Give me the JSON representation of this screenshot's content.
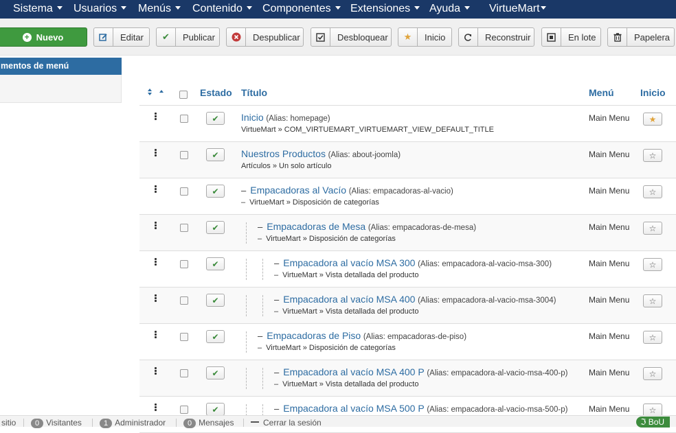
{
  "nav": {
    "items": [
      "Sistema",
      "Usuarios",
      "Menús",
      "Contenido",
      "Componentes",
      "Extensiones",
      "Ayuda",
      "VirtueMart"
    ]
  },
  "toolbar": {
    "new_label": "Nuevo",
    "edit_label": "Editar",
    "publish_label": "Publicar",
    "unpublish_label": "Despublicar",
    "checkin_label": "Desbloquear",
    "home_label": "Inicio",
    "rebuild_label": "Reconstruir",
    "batch_label": "En lote",
    "trash_label": "Papelera"
  },
  "sidebar": {
    "active_item": "mentos de menú"
  },
  "table": {
    "headers": {
      "status": "Estado",
      "title": "Título",
      "menu": "Menú",
      "home": "Inicio"
    },
    "rows": [
      {
        "title": "Inicio",
        "alias": "(Alias: homepage)",
        "sub": "VirtueMart » COM_VIRTUEMART_VIRTUEMART_VIEW_DEFAULT_TITLE",
        "menu": "Main Menu",
        "level": 1,
        "home": true
      },
      {
        "title": "Nuestros Productos",
        "alias": "(Alias: about-joomla)",
        "sub": "Artículos » Un solo artículo",
        "menu": "Main Menu",
        "level": 1,
        "home": false
      },
      {
        "title": "Empacadoras al Vacío",
        "alias": "(Alias: empacadoras-al-vacio)",
        "sub": "VirtueMart » Disposición de categorías",
        "menu": "Main Menu",
        "level": 2,
        "home": false
      },
      {
        "title": "Empacadoras de Mesa",
        "alias": "(Alias: empacadoras-de-mesa)",
        "sub": "VirtueMart » Disposición de categorías",
        "menu": "Main Menu",
        "level": 3,
        "home": false
      },
      {
        "title": "Empacadora al vacío MSA 300",
        "alias": "(Alias: empacadora-al-vacio-msa-300)",
        "sub": "VirtueMart » Vista detallada del producto",
        "menu": "Main Menu",
        "level": 4,
        "home": false
      },
      {
        "title": "Empacadora al vacío MSA 400",
        "alias": "(Alias: empacadora-al-vacio-msa-3004)",
        "sub": "VirtueMart » Vista detallada del producto",
        "menu": "Main Menu",
        "level": 4,
        "home": false
      },
      {
        "title": "Empacadoras de Piso",
        "alias": "(Alias: empacadoras-de-piso)",
        "sub": "VirtueMart » Disposición de categorías",
        "menu": "Main Menu",
        "level": 3,
        "home": false
      },
      {
        "title": "Empacadora al vacío MSA 400 P",
        "alias": "(Alias: empacadora-al-vacio-msa-400-p)",
        "sub": "VirtueMart » Vista detallada del producto",
        "menu": "Main Menu",
        "level": 4,
        "home": false
      },
      {
        "title": "Empacadora al vacío MSA 500 P",
        "alias": "(Alias: empacadora-al-vacio-msa-500-p)",
        "sub": "",
        "menu": "Main Menu",
        "level": 4,
        "home": false
      }
    ]
  },
  "statusbar": {
    "site_label": "sitio",
    "visitors_count": "0",
    "visitors_label": "Visitantes",
    "admins_count": "1",
    "admins_label": "Administrador",
    "messages_count": "0",
    "messages_label": "Mensajes",
    "logout_label": "Cerrar la sesión",
    "user_label": "BoU"
  }
}
